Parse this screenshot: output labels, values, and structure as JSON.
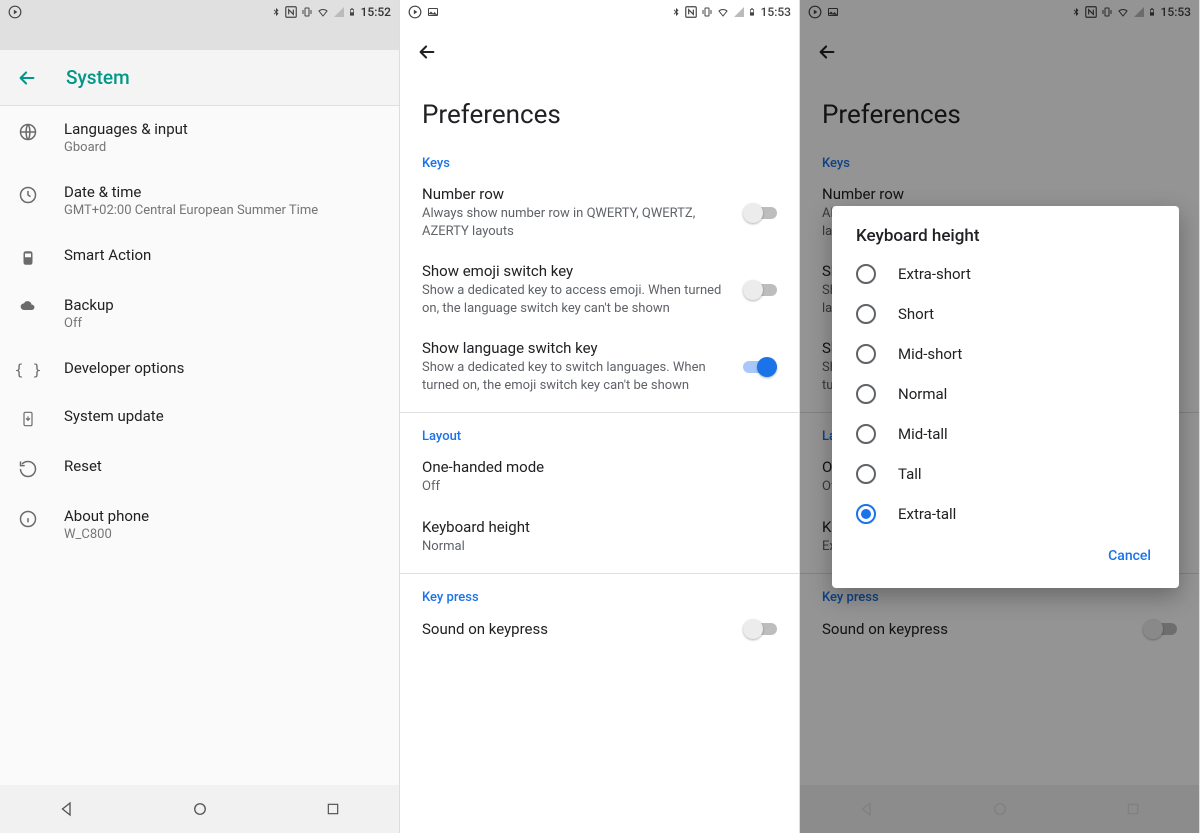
{
  "status": {
    "t1": "15:52",
    "t2": "15:53",
    "t3": "15:53"
  },
  "panel1": {
    "title": "System",
    "items": [
      {
        "title": "Languages & input",
        "sub": "Gboard"
      },
      {
        "title": "Date & time",
        "sub": "GMT+02:00 Central European Summer Time"
      },
      {
        "title": "Smart Action",
        "sub": ""
      },
      {
        "title": "Backup",
        "sub": "Off"
      },
      {
        "title": "Developer options",
        "sub": ""
      },
      {
        "title": "System update",
        "sub": ""
      },
      {
        "title": "Reset",
        "sub": ""
      },
      {
        "title": "About phone",
        "sub": "W_C800"
      }
    ]
  },
  "panel2": {
    "title": "Preferences",
    "sections": {
      "keys": "Keys",
      "layout": "Layout",
      "keypress": "Key press"
    },
    "rows": {
      "numberRow": {
        "title": "Number row",
        "sub": "Always show number row in QWERTY, QWERTZ, AZERTY layouts"
      },
      "emoji": {
        "title": "Show emoji switch key",
        "sub": "Show a dedicated key to access emoji. When turned on, the language switch key can't be shown"
      },
      "langSwitch": {
        "title": "Show language switch key",
        "sub": "Show a dedicated key to switch languages. When turned on, the emoji switch key can't be shown"
      },
      "oneHanded": {
        "title": "One-handed mode",
        "sub": "Off"
      },
      "kbHeight": {
        "title": "Keyboard height",
        "sub": "Normal"
      },
      "sound": {
        "title": "Sound on keypress",
        "sub": ""
      }
    }
  },
  "panel3": {
    "title": "Preferences",
    "kbHeightSub": "Extra-tall",
    "dialog": {
      "title": "Keyboard height",
      "options": [
        "Extra-short",
        "Short",
        "Mid-short",
        "Normal",
        "Mid-tall",
        "Tall",
        "Extra-tall"
      ],
      "selectedIndex": 6,
      "cancel": "Cancel"
    }
  }
}
